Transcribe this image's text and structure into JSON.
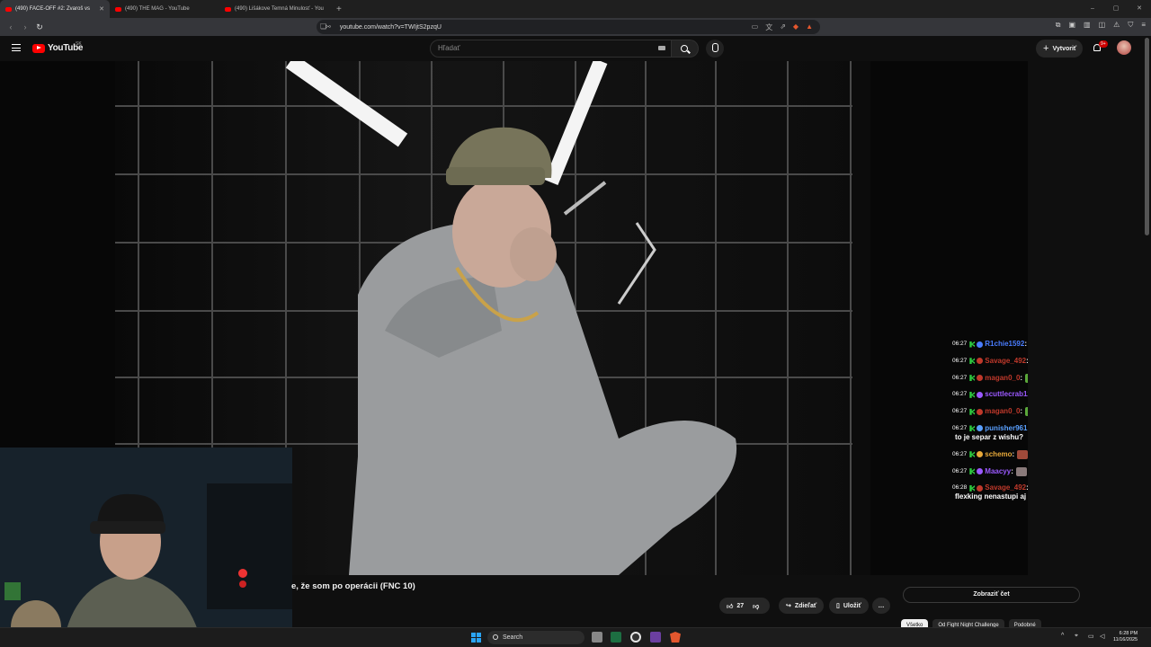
{
  "browser": {
    "tabs": [
      {
        "label": "(490) FACE-OFF #2: Zvaroš vs"
      },
      {
        "label": "(490) THE MAG - YouTube"
      },
      {
        "label": "(490) Lišákove Temná Minulosť - You"
      }
    ],
    "new_tab": "+",
    "window_controls": [
      "–",
      "▢",
      "✕"
    ],
    "url": "youtube.com/watch?v=TWIjtS2pzqU",
    "ext_badge": "1"
  },
  "youtube": {
    "logo_text": "YouTube",
    "region": "SK",
    "search_placeholder": "Hľadať",
    "create_label": "Vytvoriť",
    "create_icon": "plus-icon",
    "notif_badge": "9+"
  },
  "chat": [
    {
      "time": "06:27",
      "user": "R1chie1592",
      "color": "#4a7dff",
      "text": "",
      "emote": "#e8d23a"
    },
    {
      "time": "06:27",
      "user": "Savage_492",
      "color": "#c0392b",
      "text": "",
      "emote": "#8a5050"
    },
    {
      "time": "06:27",
      "user": "magan0_0",
      "color": "#c0392b",
      "text": "",
      "emote": "#5aa83a"
    },
    {
      "time": "06:27",
      "user": "scuttlecrab123",
      "color": "#9b59ff",
      "text": "",
      "emote": "#3ad13a"
    },
    {
      "time": "06:27",
      "user": "magan0_0",
      "color": "#c0392b",
      "text": "",
      "emote": "#5aa83a"
    },
    {
      "time": "06:27",
      "user": "punisher961",
      "color": "#5aa0ff",
      "text": "to je separ z wishu?",
      "emote": ""
    },
    {
      "time": "06:27",
      "user": "schemo",
      "color": "#e8a93a",
      "text": "",
      "emote": "#a04a3a"
    },
    {
      "time": "06:27",
      "user": "Maacyy",
      "color": "#9b59ff",
      "text": "",
      "emote": "#8a7a7a"
    },
    {
      "time": "06:28",
      "user": "Savage_492",
      "color": "#c0392b",
      "text": "flexking nenastupi aj tak",
      "emote": ""
    }
  ],
  "video": {
    "title": "e, že som po operácii (FNC 10)",
    "likes": "27",
    "share_label": "Zdieľať",
    "save_label": "Uložiť",
    "more": "…"
  },
  "sidebar": {
    "show_chat_label": "Zobraziť čet",
    "chips": [
      "Všetko",
      "Od Fight Night Challenge",
      "Podobné"
    ]
  },
  "taskbar": {
    "search_label": "Search",
    "time": "6:28 PM",
    "date": "11/16/2025",
    "tray_up": "^"
  },
  "colors": {
    "accent_red": "#ff0000",
    "windows_blue": "#2aa4f4"
  }
}
